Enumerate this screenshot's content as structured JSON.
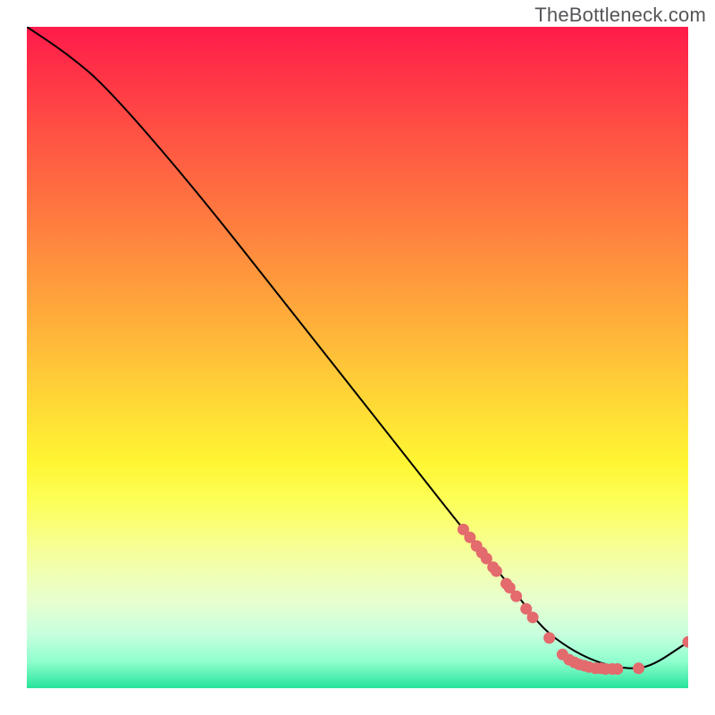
{
  "watermark": "TheBottleneck.com",
  "chart_data": {
    "type": "line",
    "title": "",
    "xlabel": "",
    "ylabel": "",
    "xlim": [
      0,
      100
    ],
    "ylim": [
      0,
      100
    ],
    "grid": false,
    "legend": false,
    "series": [
      {
        "name": "curve",
        "x": [
          0,
          6,
          12,
          25,
          40,
          55,
          66,
          71,
          75,
          78,
          82,
          86,
          90,
          94,
          100
        ],
        "y": [
          100,
          96,
          91,
          76,
          57,
          38,
          24,
          18,
          13,
          9,
          6,
          4,
          3,
          3,
          7
        ]
      }
    ],
    "markers": {
      "name": "cluster-points",
      "color": "#e36a6d",
      "points": [
        {
          "x": 66.0,
          "y": 24.0
        },
        {
          "x": 67.0,
          "y": 22.8
        },
        {
          "x": 68.0,
          "y": 21.5
        },
        {
          "x": 68.8,
          "y": 20.5
        },
        {
          "x": 69.5,
          "y": 19.6
        },
        {
          "x": 70.5,
          "y": 18.3
        },
        {
          "x": 71.0,
          "y": 17.7
        },
        {
          "x": 72.5,
          "y": 15.8
        },
        {
          "x": 73.0,
          "y": 15.2
        },
        {
          "x": 74.0,
          "y": 13.9
        },
        {
          "x": 75.5,
          "y": 12.0
        },
        {
          "x": 76.5,
          "y": 10.7
        },
        {
          "x": 79.0,
          "y": 7.6
        },
        {
          "x": 81.0,
          "y": 5.1
        },
        {
          "x": 82.0,
          "y": 4.3
        },
        {
          "x": 82.8,
          "y": 3.9
        },
        {
          "x": 83.5,
          "y": 3.6
        },
        {
          "x": 84.3,
          "y": 3.4
        },
        {
          "x": 85.0,
          "y": 3.2
        },
        {
          "x": 86.0,
          "y": 3.0
        },
        {
          "x": 86.8,
          "y": 3.0
        },
        {
          "x": 87.5,
          "y": 2.9
        },
        {
          "x": 88.5,
          "y": 2.9
        },
        {
          "x": 89.3,
          "y": 2.9
        },
        {
          "x": 92.5,
          "y": 3.0
        },
        {
          "x": 100.0,
          "y": 7.0
        }
      ]
    }
  }
}
